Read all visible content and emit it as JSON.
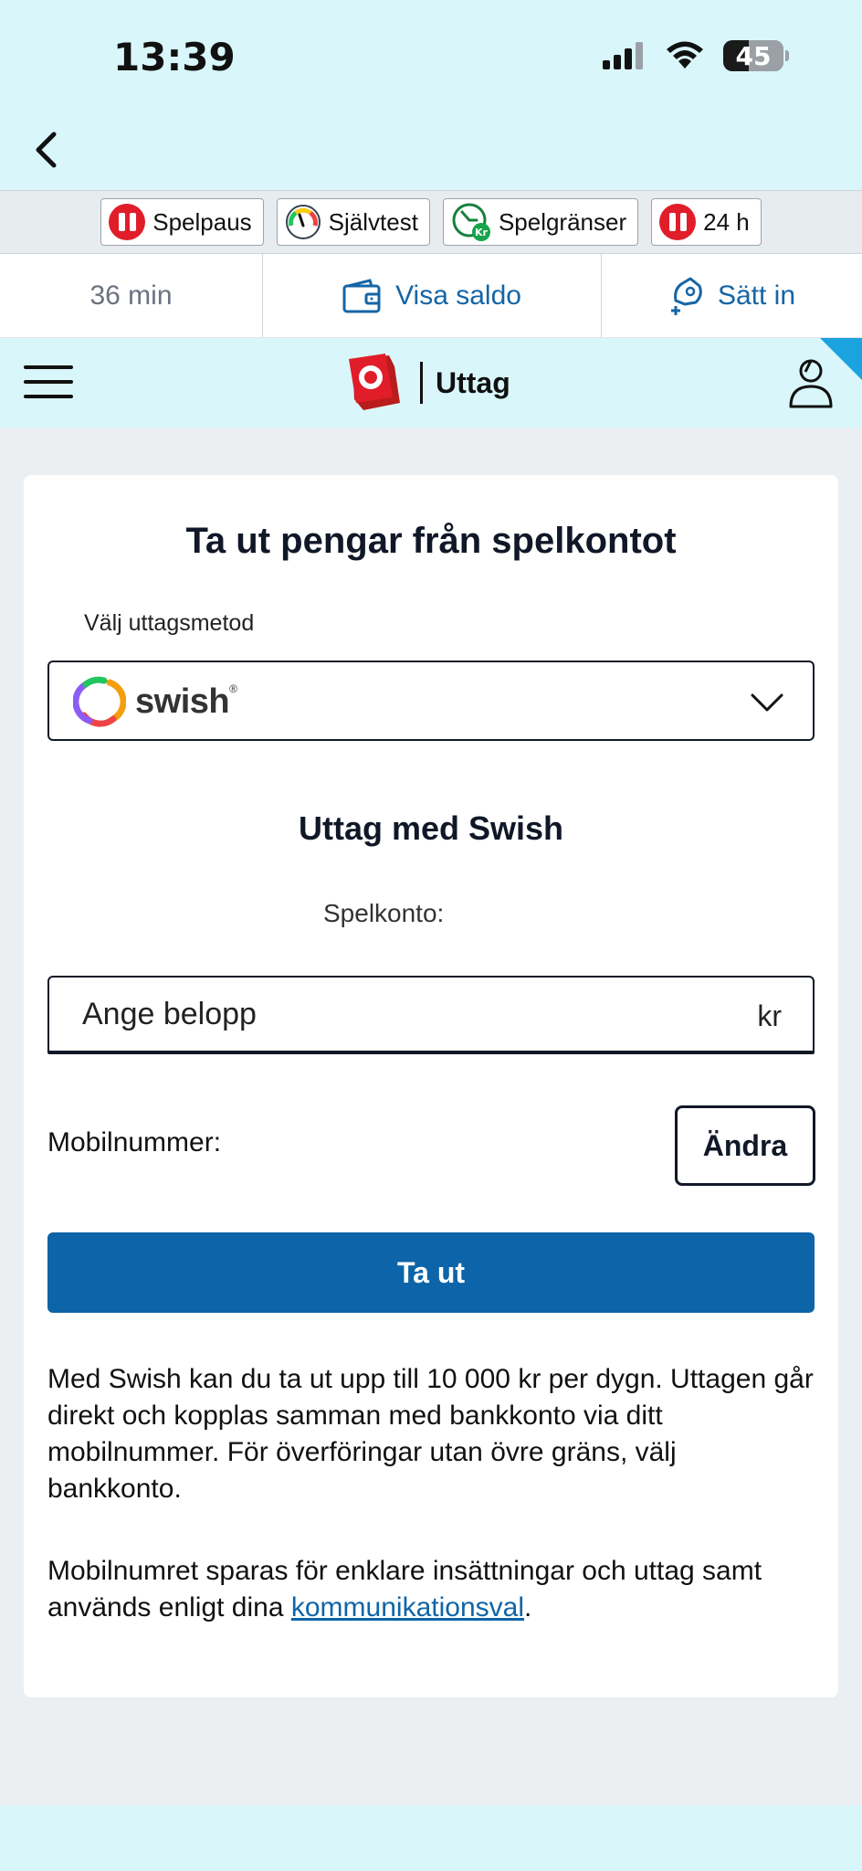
{
  "status_bar": {
    "time": "13:39",
    "battery_level": "45"
  },
  "responsible_gaming": {
    "items": [
      {
        "label": "Spelpaus",
        "icon": "pause-icon"
      },
      {
        "label": "Självtest",
        "icon": "gauge-icon"
      },
      {
        "label": "Spelgränser",
        "icon": "limits-clock-icon"
      },
      {
        "label": "24 h",
        "icon": "pause-icon"
      }
    ]
  },
  "info_bar": {
    "session_time": "36 min",
    "saldo_label": "Visa saldo",
    "deposit_label": "Sätt in"
  },
  "nav": {
    "title": "Uttag"
  },
  "form": {
    "title": "Ta ut pengar från spelkontot",
    "method_label": "Välj uttagsmetod",
    "selected_method": "swish",
    "section_title": "Uttag med Swish",
    "account_label": "Spelkonto:",
    "amount_placeholder": "Ange belopp",
    "amount_suffix": "kr",
    "mobile_label": "Mobilnummer:",
    "change_button": "Ändra",
    "submit_button": "Ta ut",
    "info_paragraph": "Med Swish kan du ta ut upp till 10 000 kr per dygn. Uttagen går direkt och kopplas samman med bankkonto via ditt mobilnummer. För överföringar utan övre gräns, välj bankkonto.",
    "consent_text_before": "Mobilnumret sparas för enklare insättningar och uttag samt används enligt dina ",
    "consent_link": "kommunikationsval",
    "consent_text_after": "."
  },
  "colors": {
    "header_bg": "#d9f7fa",
    "primary": "#0d64a8",
    "link": "#1565a6",
    "danger": "#e11d2a",
    "page_bg": "#eceff2"
  }
}
